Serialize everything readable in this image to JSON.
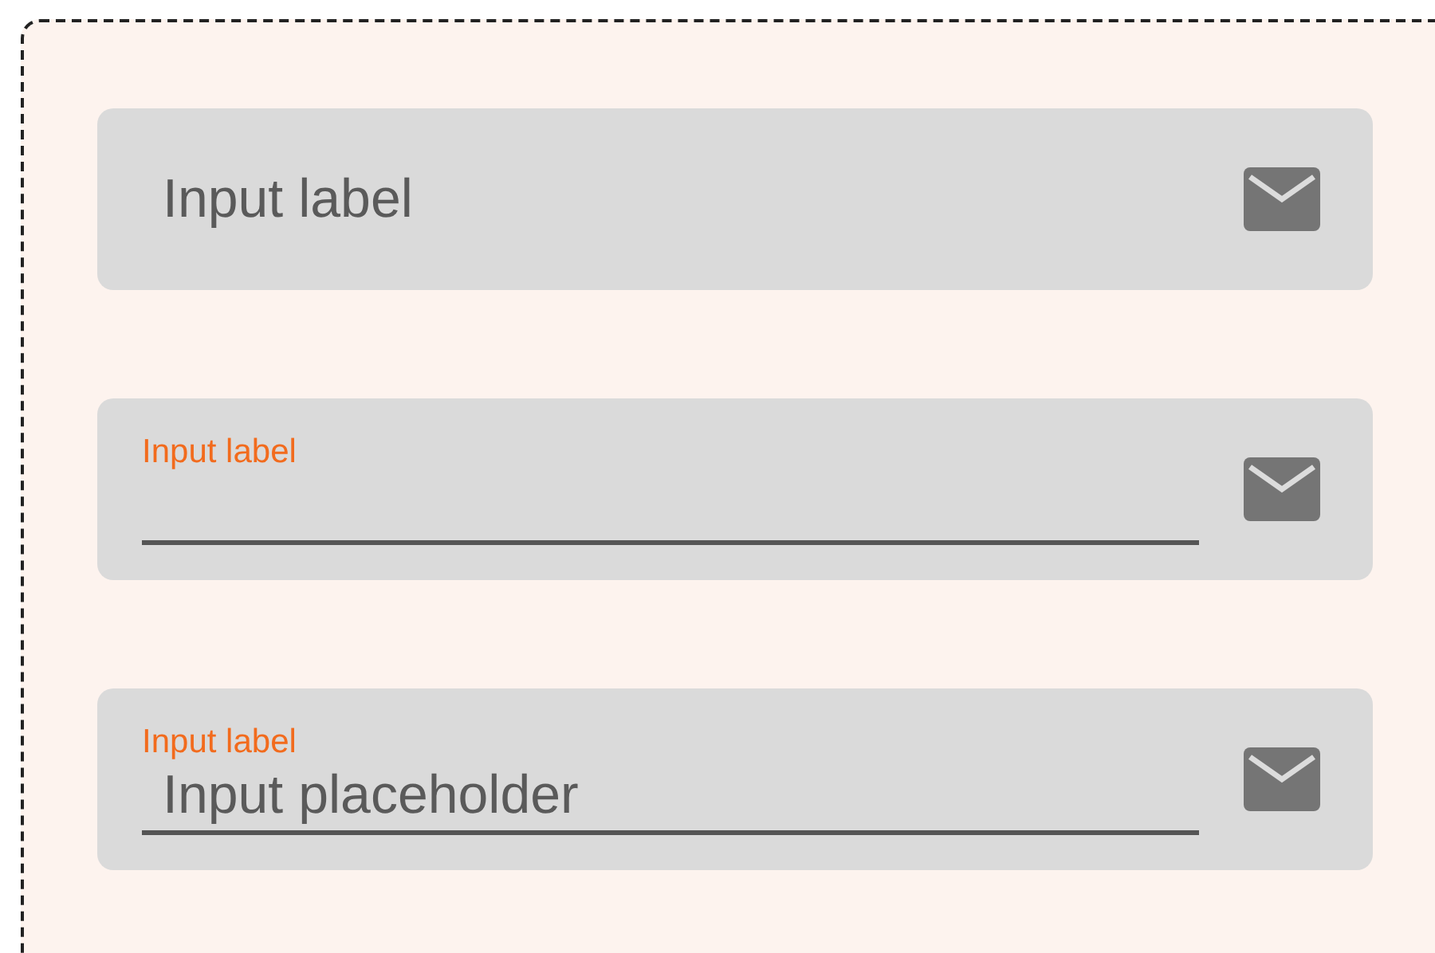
{
  "fields": [
    {
      "kind": "resting",
      "label": "Input label"
    },
    {
      "kind": "focused",
      "label": "Input label"
    },
    {
      "kind": "filled",
      "label": "Input label",
      "placeholder": "Input placeholder"
    }
  ]
}
